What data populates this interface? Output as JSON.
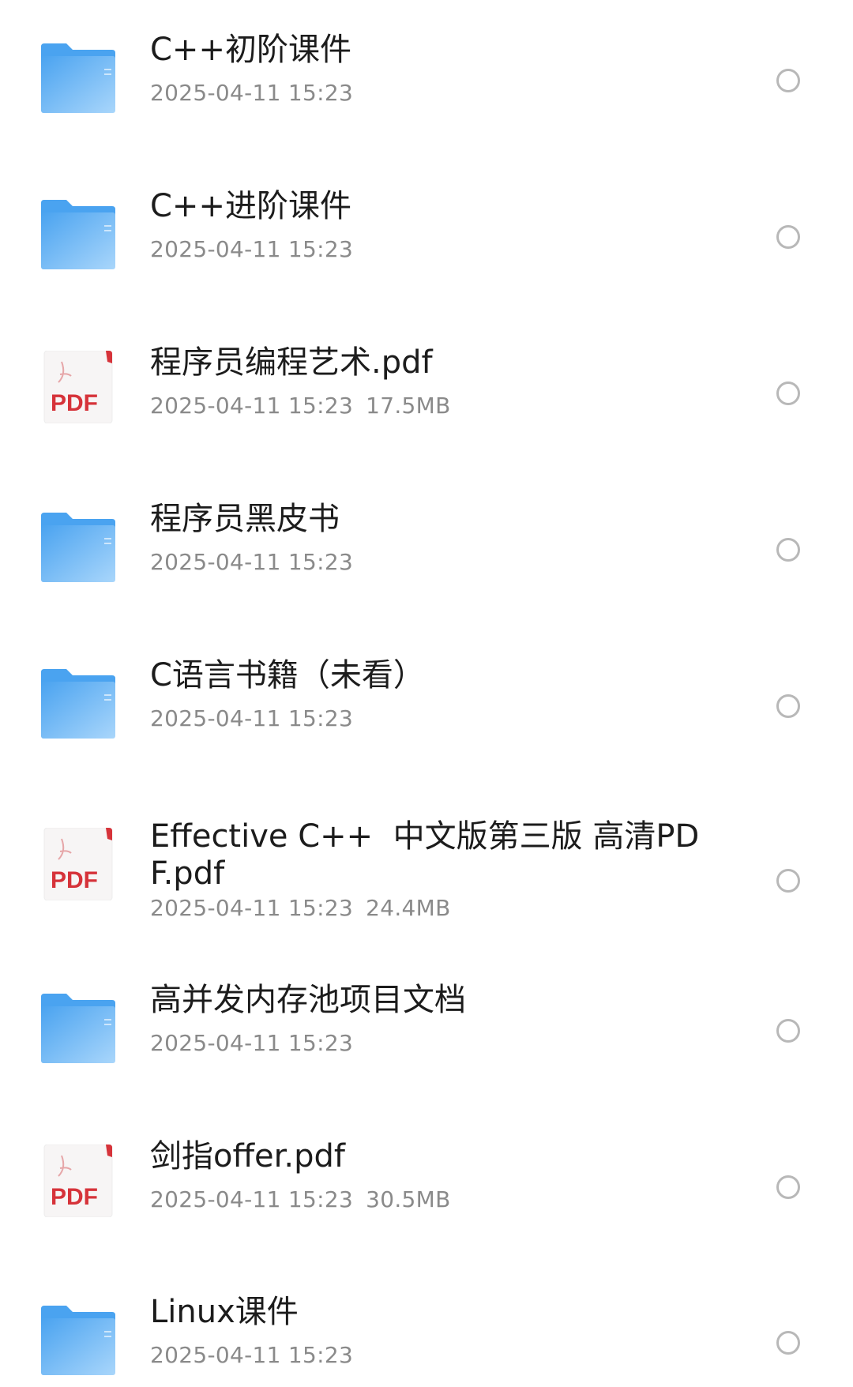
{
  "colors": {
    "folder_primary": "#4aa3f0",
    "folder_light": "#a9d6fb",
    "pdf_red": "#d6333a",
    "name_text": "#1c1c1c",
    "meta_text": "#8a8a8a",
    "radio_border": "#b8b8b8"
  },
  "files": [
    {
      "type": "folder",
      "icon": "folder-icon",
      "name": "C++初阶课件",
      "date": "2025-04-11 15:23",
      "size": ""
    },
    {
      "type": "folder",
      "icon": "folder-icon",
      "name": "C++进阶课件",
      "date": "2025-04-11 15:23",
      "size": ""
    },
    {
      "type": "pdf",
      "icon": "pdf-file-icon",
      "icon_label": "PDF",
      "name": "程序员编程艺术.pdf",
      "date": "2025-04-11 15:23",
      "size": "17.5MB"
    },
    {
      "type": "folder",
      "icon": "folder-icon",
      "name": "程序员黑皮书",
      "date": "2025-04-11 15:23",
      "size": ""
    },
    {
      "type": "folder",
      "icon": "folder-icon",
      "name": "C语言书籍（未看）",
      "date": "2025-04-11 15:23",
      "size": ""
    },
    {
      "type": "pdf",
      "icon": "pdf-file-icon",
      "icon_label": "PDF",
      "name": "Effective C++  中文版第三版 高清PDF.pdf",
      "date": "2025-04-11 15:23",
      "size": "24.4MB"
    },
    {
      "type": "folder",
      "icon": "folder-icon",
      "name": "高并发内存池项目文档",
      "date": "2025-04-11 15:23",
      "size": ""
    },
    {
      "type": "pdf",
      "icon": "pdf-file-icon",
      "icon_label": "PDF",
      "name": "剑指offer.pdf",
      "date": "2025-04-11 15:23",
      "size": "30.5MB"
    },
    {
      "type": "folder",
      "icon": "folder-icon",
      "name": "Linux课件",
      "date": "2025-04-11 15:23",
      "size": ""
    }
  ]
}
